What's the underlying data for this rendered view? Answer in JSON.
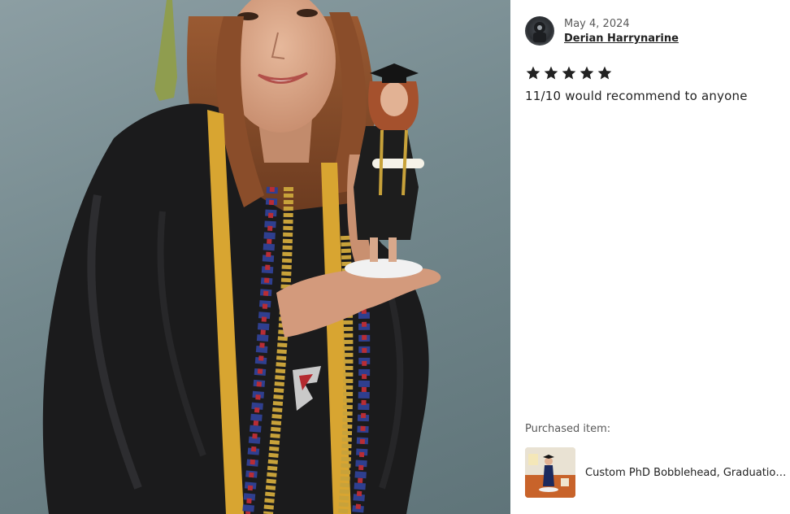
{
  "review": {
    "date": "May 4, 2024",
    "reviewer_name": "Derian Harrynarine",
    "rating": 5,
    "rating_max": 5,
    "text": "11/10 would recommend to anyone",
    "purchased_label": "Purchased item:",
    "purchased_item_title": "Custom PhD Bobblehead, Graduation Gift"
  },
  "icons": {
    "star": "star-icon",
    "avatar": "user-avatar"
  },
  "colors": {
    "star": "#222222",
    "wall": "#7d9095",
    "gown": "#1a1a1a",
    "gold_cord": "#c8a23a"
  }
}
